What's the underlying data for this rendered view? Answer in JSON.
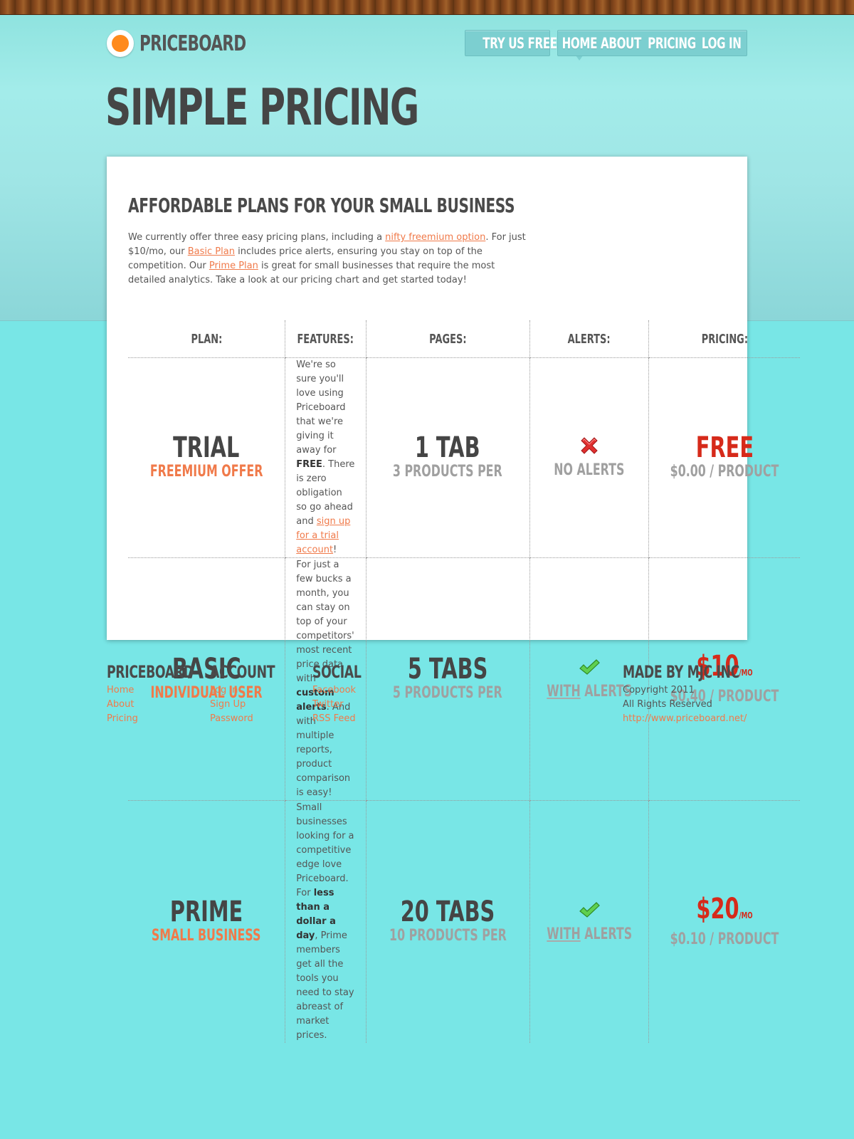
{
  "brand": {
    "name": "PRICEBOARD"
  },
  "nav": {
    "cta": "TRY US FREE",
    "items": [
      "HOME",
      "ABOUT",
      "PRICING",
      "LOG IN"
    ]
  },
  "page_title": "SIMPLE PRICING",
  "card": {
    "subtitle": "AFFORDABLE PLANS FOR YOUR SMALL BUSINESS",
    "intro": {
      "p1": "We currently offer three easy pricing plans, including a ",
      "link1": "nifty freemium option",
      "p2": ". For just $10/mo, our ",
      "link2": "Basic Plan",
      "p3": " includes price alerts, ensuring you stay on top of the competition. Our ",
      "link3": "Prime Plan",
      "p4": " is great for small businesses that require the most detailed analytics. Take a look at our pricing chart and get started today!"
    },
    "table": {
      "headers": [
        "PLAN:",
        "FEATURES:",
        "PAGES:",
        "ALERTS:",
        "PRICING:"
      ],
      "rows": [
        {
          "name": "TRIAL",
          "sub": "FREEMIUM OFFER",
          "feat_a": "We're so sure you'll love using Priceboard that we're giving it away for ",
          "feat_b": "FREE",
          "feat_c": ". There is zero obligation so go ahead and ",
          "feat_link": "sign up for a trial account",
          "feat_d": "!",
          "pages": "1 TAB",
          "products": "3 PRODUCTS PER",
          "alert_icon": "x-icon",
          "alert_with": "",
          "alert_text": "NO ALERTS",
          "price": "FREE",
          "per": "",
          "per_product": "$0.00 / PRODUCT"
        },
        {
          "name": "BASIC",
          "sub": "INDIVIDUAL USER",
          "feat_a": "For just a few bucks a month, you can stay on top of your competitors' most recent price data with ",
          "feat_b": "custom alerts",
          "feat_c": ". And with multiple reports, product comparison is easy!",
          "feat_link": "",
          "feat_d": "",
          "pages": "5 TABS",
          "products": "5 PRODUCTS PER",
          "alert_icon": "check-icon",
          "alert_with": "WITH",
          "alert_text": " ALERTS",
          "price": "$10",
          "per": "/MO",
          "per_product": "$0.40 / PRODUCT"
        },
        {
          "name": "PRIME",
          "sub": "SMALL BUSINESS",
          "feat_a": "Small businesses looking for a competitive edge love Priceboard. For ",
          "feat_b": "less than a dollar a day",
          "feat_c": ", Prime members get all the tools you need to stay abreast of market prices.",
          "feat_link": "",
          "feat_d": "",
          "pages": "20 TABS",
          "products": "10 PRODUCTS PER",
          "alert_icon": "check-icon",
          "alert_with": "WITH",
          "alert_text": " ALERTS",
          "price": "$20",
          "per": "/MO",
          "per_product": "$0.10 / PRODUCT"
        }
      ]
    }
  },
  "footer": {
    "col1": {
      "title": "PRICEBOARD",
      "links": [
        "Home",
        "About",
        "Pricing"
      ]
    },
    "col2": {
      "title": "ACCOUNT",
      "links": [
        "Log In",
        "Sign Up",
        "Password"
      ]
    },
    "col3": {
      "title": "SOCIAL",
      "links": [
        "Facebook",
        "Twitter",
        "RSS Feed"
      ]
    },
    "col4": {
      "title": "MADE BY MJC INC",
      "line1": "Copyright 2011",
      "line2": "All Rights Reserved",
      "link": "http://www.priceboard.net/"
    }
  },
  "colors": {
    "accent": "#f07a4a",
    "price_red": "#d62a1a",
    "background": "#78e6e6",
    "logo_orange": "#ff8a1c"
  }
}
